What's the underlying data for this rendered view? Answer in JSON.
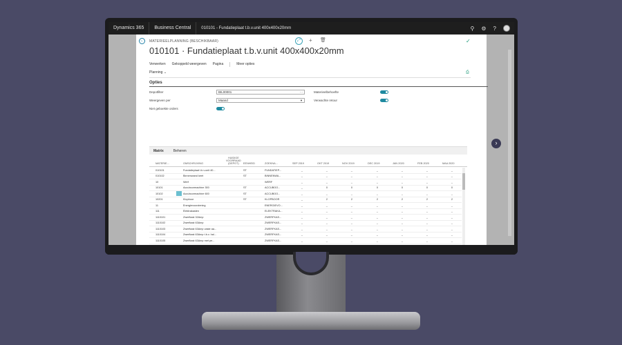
{
  "topbar": {
    "app": "Dynamics 365",
    "module": "Business Central",
    "crumb": "010101 - Fundatieplaat t.b.v.unit 400x400x20mm"
  },
  "header": {
    "caption": "MATERIEELPLANNING (BESCHIKBAAR)",
    "title": "010101 · Fundatieplaat t.b.v.unit 400x400x20mm"
  },
  "actions": [
    "Verwerken",
    "Gekoppeld weergeven",
    "Pagina",
    "Meer opties"
  ],
  "planning_label": "Planning",
  "opties": {
    "heading": "Opties",
    "depotfilter_label": "Depotfilter",
    "depotfilter_value": "BIL00001",
    "weergeven_label": "Weergeven per",
    "weergeven_value": "Maand",
    "niet_geboekte_label": "Niet geboekte orders",
    "materieelbehoefte_label": "Materieelbehoefte",
    "verwachte_retour_label": "Verwachte retour"
  },
  "matrix": {
    "tabs": [
      "Matrix",
      "Beheren"
    ],
    "headers": {
      "nr": "MATERIE...",
      "omschrijving": "OMSCHRIJVING",
      "huidige": [
        "HUIDIGE",
        "VOORRAAD",
        "(DEPOT)"
      ],
      "eenheid": "EENHEID",
      "zoekna": "ZOEKNA...",
      "months": [
        "SEP 2019",
        "OKT 2019",
        "NOV 2019",
        "DEC 2019",
        "JAN 2020",
        "FEB 2020",
        "MAA 2020"
      ]
    },
    "rows": [
      {
        "nr": "010101",
        "oms": "Fundatieplaat t.b.v.unit 40...",
        "eh": "ST",
        "zk": "FUNDATIEP...",
        "m": [
          "_",
          "_",
          "_",
          "_",
          "_",
          "_",
          "_"
        ]
      },
      {
        "nr": "010102",
        "oms": "Binnenwand keet",
        "eh": "ST",
        "zk": "BINNENWA...",
        "m": [
          "_",
          "_",
          "_",
          "_",
          "_",
          "_",
          "_"
        ]
      },
      {
        "nr": "10",
        "oms": "Werf",
        "eh": "",
        "zk": "WERF",
        "m": [
          "_",
          "_",
          "_",
          "_",
          "_",
          "_",
          "_"
        ]
      },
      {
        "nr": "10101",
        "oms": "Accuboormachine 300",
        "eh": "ST",
        "zk": "ACCUBOO...",
        "m": [
          "_",
          "0",
          "0",
          "0",
          "0",
          "0",
          "0"
        ]
      },
      {
        "nr": "10102",
        "oms": "Accuboormachine 600",
        "eh": "ST",
        "zk": "ACCUBOO...",
        "m": [
          "_",
          "_",
          "_",
          "_",
          "_",
          "_",
          "_"
        ]
      },
      {
        "nr": "10201",
        "oms": "Klopboor",
        "eh": "ST",
        "zk": "KLOPBOOR",
        "m": [
          "_",
          "2",
          "2",
          "2",
          "2",
          "2",
          "2"
        ]
      },
      {
        "nr": "11",
        "oms": "Energievoorziening",
        "eh": "",
        "zk": "ENERGIEVO...",
        "m": [
          "_",
          "_",
          "_",
          "_",
          "_",
          "_",
          "_"
        ]
      },
      {
        "nr": "111",
        "oms": "Elektrakasten",
        "eh": "",
        "zk": "ELEKTRAKA...",
        "m": [
          "_",
          "_",
          "_",
          "_",
          "_",
          "_",
          "_"
        ]
      },
      {
        "nr": "1110101",
        "oms": "Zwerfkast 32Amp",
        "eh": "",
        "zk": "ZWERFKAS...",
        "m": [
          "_",
          "_",
          "_",
          "_",
          "_",
          "_",
          "_"
        ]
      },
      {
        "nr": "1110102",
        "oms": "Zwerfkast 63Amp",
        "eh": "",
        "zk": "ZWERFKAS...",
        "m": [
          "_",
          "_",
          "_",
          "_",
          "_",
          "_",
          "_"
        ]
      },
      {
        "nr": "1110103",
        "oms": "Zwerfkast 63Amp vaste aa...",
        "eh": "",
        "zk": "ZWERFKAS...",
        "m": [
          "_",
          "_",
          "_",
          "_",
          "_",
          "_",
          "_"
        ]
      },
      {
        "nr": "1110104",
        "oms": "Zwerfkast 63Amp t.b.v. hal...",
        "eh": "",
        "zk": "ZWERFKAS...",
        "m": [
          "_",
          "_",
          "_",
          "_",
          "_",
          "_",
          "_"
        ]
      },
      {
        "nr": "1110105",
        "oms": "Zwerfkast 63Amp met pe...",
        "eh": "",
        "zk": "ZWERFKAS...",
        "m": [
          "_",
          "_",
          "_",
          "_",
          "_",
          "_",
          "_"
        ]
      },
      {
        "nr": "1110106",
        "oms": "Zwerfkast 63Amp vaste aa...",
        "eh": "",
        "zk": "ZWERFKAS...",
        "m": [
          "_",
          "_",
          "_",
          "_",
          "_",
          "_",
          "_"
        ]
      },
      {
        "nr": "1110107",
        "oms": "Zwerfkast 63Amp met pe...",
        "eh": "",
        "zk": "ZWERFKAS...",
        "m": [
          "_",
          "_",
          "_",
          "_",
          "_",
          "_",
          "_"
        ]
      },
      {
        "nr": "1110108",
        "oms": "Zwerfkast 63Amp Monpen...",
        "eh": "",
        "zk": "ZWERFKAS...",
        "m": [
          "_",
          "_",
          "_",
          "_",
          "_",
          "_",
          "_"
        ]
      }
    ]
  },
  "icons": [
    "lightbulb-icon",
    "gear-icon",
    "help-icon",
    "avatar",
    "back-icon",
    "expand-icon",
    "plus-icon",
    "trash-icon",
    "check-icon",
    "pin-icon",
    "chevron-right-icon"
  ]
}
